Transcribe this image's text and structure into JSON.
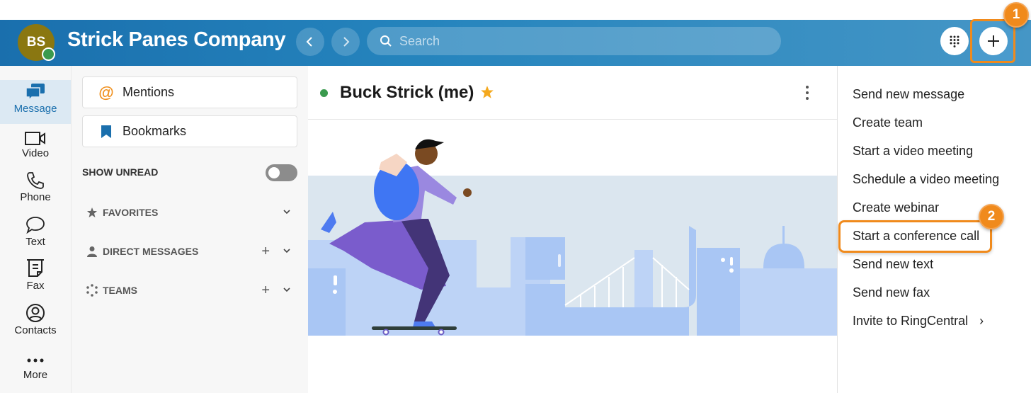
{
  "header": {
    "avatar_initials": "BS",
    "company_name": "Strick Panes Company",
    "search_placeholder": "Search",
    "back_icon": "chevron-left-icon",
    "forward_icon": "chevron-right-icon",
    "dialpad_icon": "dialpad-icon",
    "new_action_icon": "plus-icon"
  },
  "annotations": {
    "step1": "1",
    "step2": "2",
    "accent_color": "#f08a1c"
  },
  "leftnav": {
    "items": [
      {
        "label": "Message",
        "icon": "message-icon",
        "active": true
      },
      {
        "label": "Video",
        "icon": "video-icon"
      },
      {
        "label": "Phone",
        "icon": "phone-icon"
      },
      {
        "label": "Text",
        "icon": "text-bubble-icon"
      },
      {
        "label": "Fax",
        "icon": "fax-icon"
      },
      {
        "label": "Contacts",
        "icon": "contacts-icon"
      },
      {
        "label": "More",
        "icon": "more-icon"
      }
    ]
  },
  "panel": {
    "mentions_label": "Mentions",
    "bookmarks_label": "Bookmarks",
    "show_unread_label": "SHOW UNREAD",
    "show_unread_on": false,
    "sections": [
      {
        "label": "FAVORITES",
        "icon": "star-icon"
      },
      {
        "label": "DIRECT MESSAGES",
        "icon": "person-icon",
        "add": "+"
      },
      {
        "label": "TEAMS",
        "icon": "teams-icon",
        "add": "+"
      }
    ]
  },
  "conversation": {
    "title": "Buck Strick (me)",
    "status": "online",
    "favorited": true
  },
  "menu": {
    "items": [
      {
        "label": "Send new message"
      },
      {
        "label": "Create team"
      },
      {
        "label": "Start a video meeting"
      },
      {
        "label": "Schedule a video meeting"
      },
      {
        "label": "Create webinar"
      },
      {
        "label": "Start a conference call",
        "highlighted": true
      },
      {
        "label": "Send new text"
      },
      {
        "label": "Send new fax"
      },
      {
        "label": "Invite to RingCentral",
        "submenu_arrow": "›"
      }
    ]
  },
  "colors": {
    "brand_blue": "#1a6fad",
    "presence_green": "#3a9a4e",
    "star_gold": "#f4a81d",
    "mention_orange": "#f0901e"
  }
}
